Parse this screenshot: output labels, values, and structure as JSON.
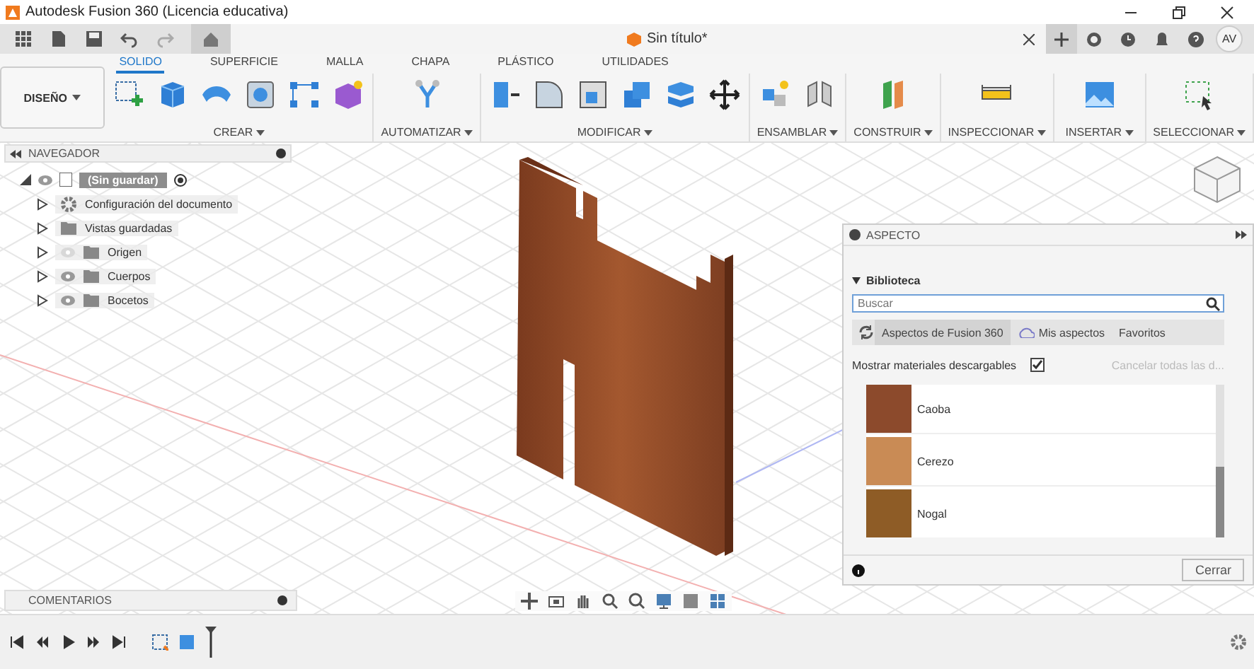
{
  "window": {
    "title": "Autodesk Fusion 360 (Licencia educativa)"
  },
  "app_bar": {
    "document_tab": "Sin título*",
    "user_initials": "AV"
  },
  "ribbon": {
    "workspace": "DISEÑO",
    "tabs": [
      {
        "label": "SOLIDO",
        "selected": true
      },
      {
        "label": "SUPERFICIE",
        "selected": false
      },
      {
        "label": "MALLA",
        "selected": false
      },
      {
        "label": "CHAPA",
        "selected": false
      },
      {
        "label": "PLÁSTICO",
        "selected": false
      },
      {
        "label": "UTILIDADES",
        "selected": false
      }
    ],
    "groups": [
      {
        "label": "CREAR"
      },
      {
        "label": "AUTOMATIZAR"
      },
      {
        "label": "MODIFICAR"
      },
      {
        "label": "ENSAMBLAR"
      },
      {
        "label": "CONSTRUIR"
      },
      {
        "label": "INSPECCIONAR"
      },
      {
        "label": "INSERTAR"
      },
      {
        "label": "SELECCIONAR"
      }
    ]
  },
  "navigator": {
    "title": "NAVEGADOR",
    "root": {
      "label": "(Sin guardar)",
      "expanded": true,
      "children": [
        {
          "label": "Configuración del documento",
          "kind": "settings"
        },
        {
          "label": "Vistas guardadas",
          "kind": "views"
        },
        {
          "label": "Origen",
          "kind": "folder",
          "visible": false
        },
        {
          "label": "Cuerpos",
          "kind": "folder",
          "visible": true
        },
        {
          "label": "Bocetos",
          "kind": "folder",
          "visible": true
        }
      ]
    }
  },
  "comments": {
    "title": "COMENTARIOS"
  },
  "aspect_panel": {
    "title": "ASPECTO",
    "section": {
      "label": "Biblioteca",
      "expanded": true
    },
    "search": {
      "placeholder": "Buscar"
    },
    "tabs": [
      {
        "label": "Aspectos de Fusion 360",
        "selected": true
      },
      {
        "label": "Mis aspectos",
        "selected": false
      },
      {
        "label": "Favoritos",
        "selected": false
      }
    ],
    "download_option": {
      "label": "Mostrar materiales descargables",
      "checked": true
    },
    "cancel_link": {
      "label": "Cancelar todas las d...",
      "disabled": true
    },
    "materials": [
      {
        "name": "Caoba",
        "color": "#8c4a2c"
      },
      {
        "name": "Cerezo",
        "color": "#c98b55"
      },
      {
        "name": "Nogal",
        "color": "#8e5c26"
      }
    ],
    "close_button": "Cerrar"
  }
}
